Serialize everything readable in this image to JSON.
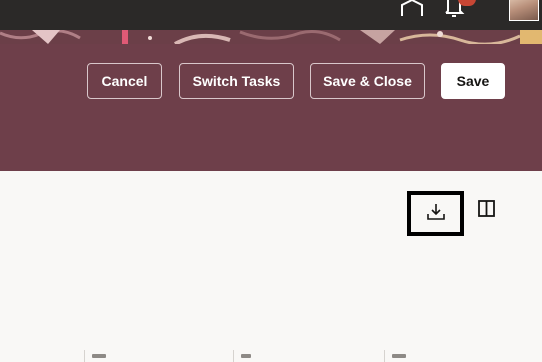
{
  "topbar": {
    "icons": [
      "home-icon",
      "bell-icon"
    ],
    "avatar": "user-avatar"
  },
  "actions": {
    "cancel_label": "Cancel",
    "switch_tasks_label": "Switch Tasks",
    "save_close_label": "Save & Close",
    "save_label": "Save"
  },
  "toolbar": {
    "icons": [
      "download-icon",
      "column-panel-icon"
    ]
  },
  "colors": {
    "header": "#6e3f4a",
    "topbar": "#2b2928",
    "page": "#f9f8f6",
    "badge": "#c74634"
  }
}
